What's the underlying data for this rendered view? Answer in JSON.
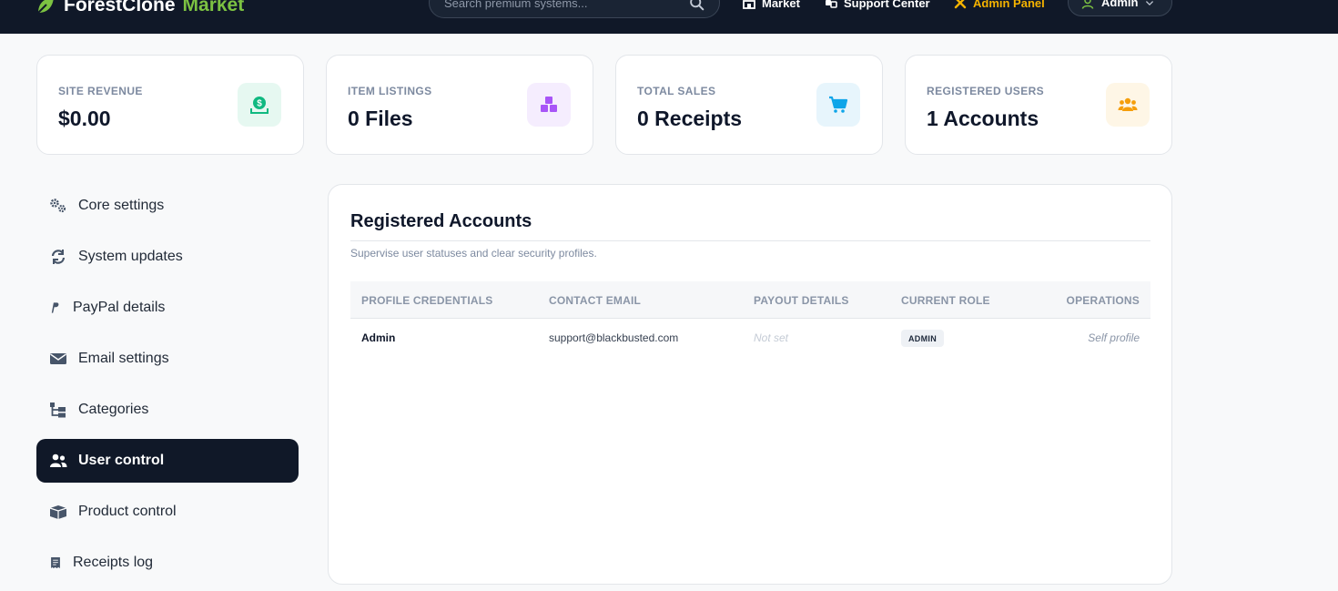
{
  "brand": {
    "name_primary": "ForestClone",
    "name_accent": "Market"
  },
  "search": {
    "placeholder": "Search premium systems..."
  },
  "nav": {
    "market": "Market",
    "support": "Support Center",
    "admin_panel": "Admin Panel",
    "user": "Admin"
  },
  "stats": [
    {
      "label": "SITE REVENUE",
      "value": "$0.00",
      "icon": "money-icon",
      "color": "#10b981",
      "bg": "#e6f8f1"
    },
    {
      "label": "ITEM LISTINGS",
      "value": "0 Files",
      "icon": "boxes-icon",
      "color": "#a855f7",
      "bg": "#f5edfe"
    },
    {
      "label": "TOTAL SALES",
      "value": "0 Receipts",
      "icon": "cart-icon",
      "color": "#0ea5e9",
      "bg": "#e7f5fc"
    },
    {
      "label": "REGISTERED USERS",
      "value": "1 Accounts",
      "icon": "users-icon",
      "color": "#f59e0b",
      "bg": "#fef6e6"
    }
  ],
  "sidebar": {
    "items": [
      {
        "label": "Core settings",
        "icon": "gears-icon"
      },
      {
        "label": "System updates",
        "icon": "sync-icon"
      },
      {
        "label": "PayPal details",
        "icon": "paypal-icon"
      },
      {
        "label": "Email settings",
        "icon": "envelope-icon"
      },
      {
        "label": "Categories",
        "icon": "sitemap-icon"
      },
      {
        "label": "User control",
        "icon": "users-icon",
        "active": true
      },
      {
        "label": "Product control",
        "icon": "boxes-icon"
      },
      {
        "label": "Receipts log",
        "icon": "receipt-icon"
      }
    ]
  },
  "panel": {
    "title": "Registered Accounts",
    "subtitle": "Supervise user statuses and clear security profiles.",
    "columns": [
      "PROFILE CREDENTIALS",
      "CONTACT EMAIL",
      "PAYOUT DETAILS",
      "CURRENT ROLE",
      "OPERATIONS"
    ],
    "rows": [
      {
        "name": "Admin",
        "email": "support@blackbusted.com",
        "payout": "Not set",
        "role": "ADMIN",
        "operations": "Self profile"
      }
    ]
  },
  "colors": {
    "navbar": "#101828",
    "brand_accent": "#7cc242",
    "admin_link": "#f5b300",
    "active_item": "#101828"
  }
}
